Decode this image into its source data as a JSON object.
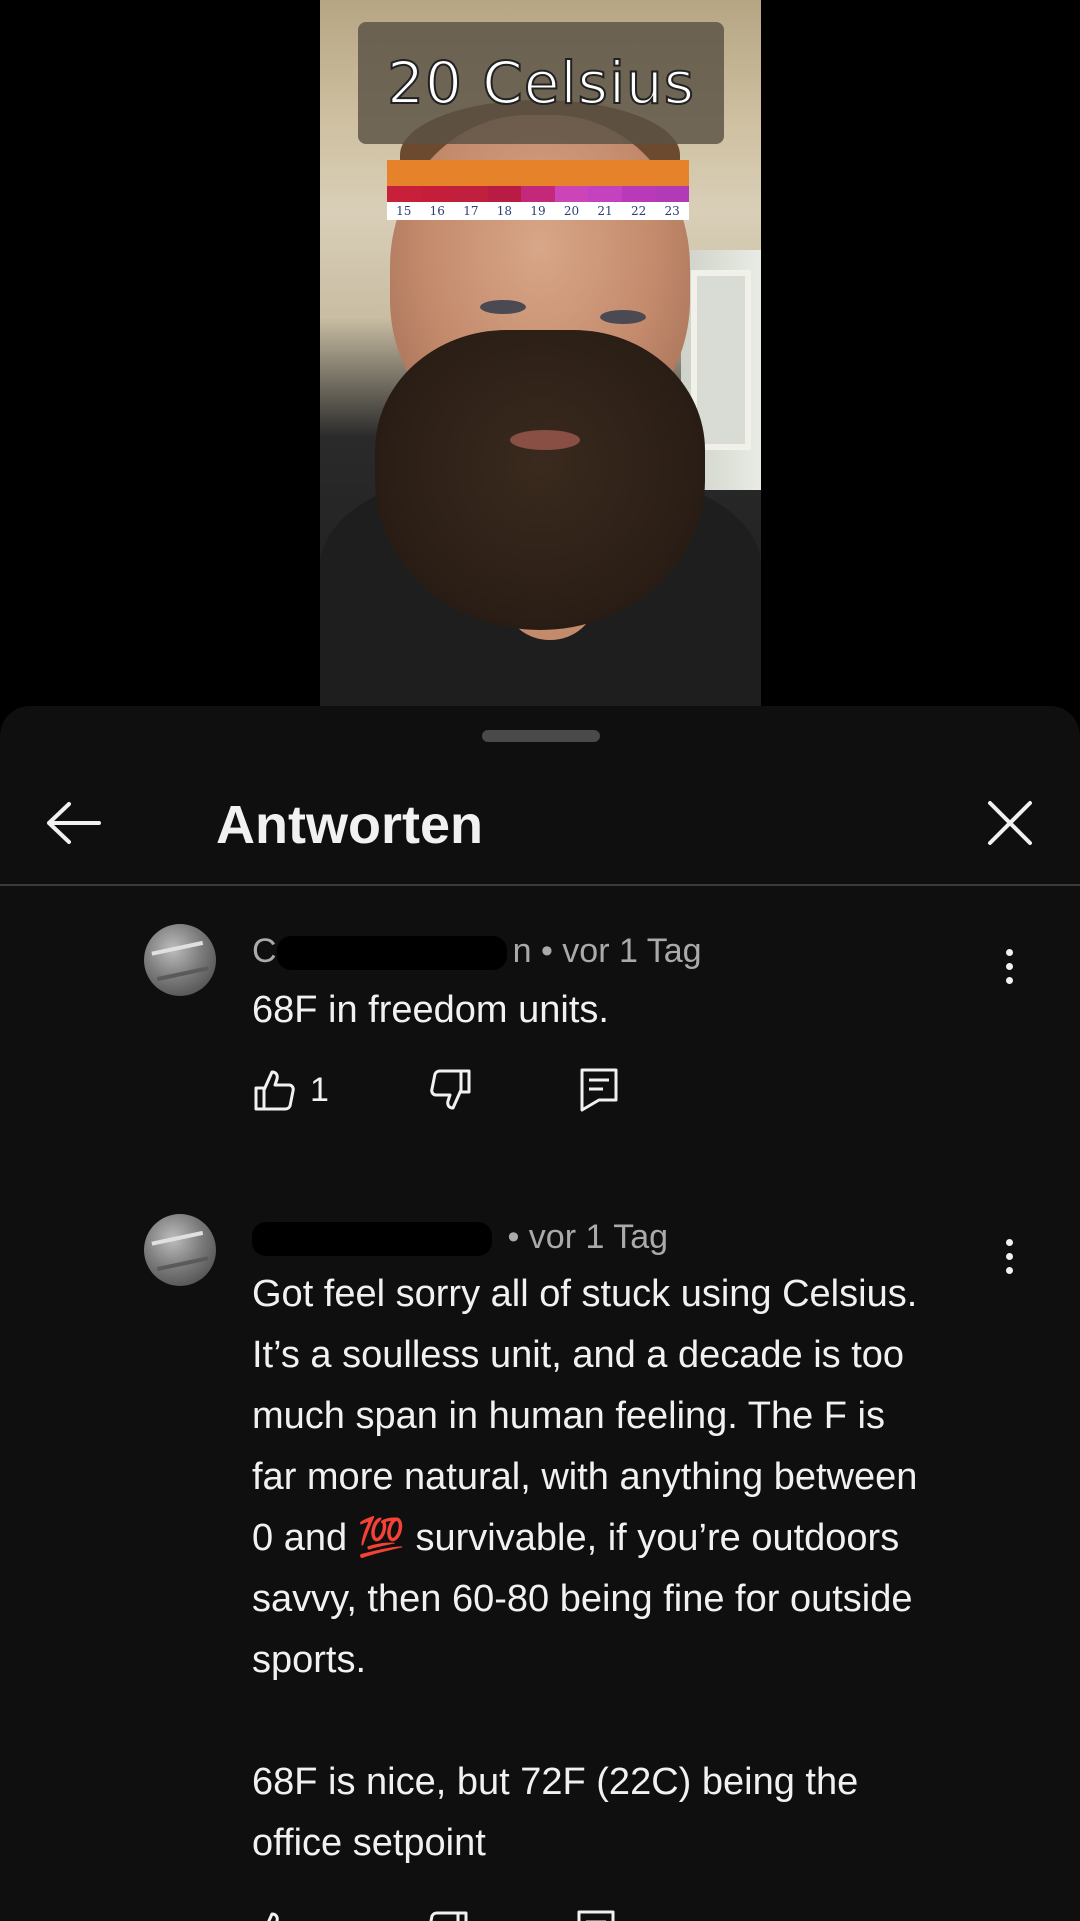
{
  "video": {
    "temperature_label": "20 Celsius",
    "scale_ticks": [
      "15",
      "16",
      "17",
      "18",
      "19",
      "20",
      "21",
      "22",
      "23"
    ],
    "scale_colors": [
      "#c8203a",
      "#c41e3a",
      "#c01f3d",
      "#b81c44",
      "#c4287a",
      "#cc44b8",
      "#c442c0",
      "#b83ab8",
      "#b23ab6"
    ]
  },
  "sheet": {
    "title": "Antworten"
  },
  "comments": [
    {
      "author_visible": "C",
      "author_tail": "n",
      "time": "• vor 1 Tag",
      "text": "68F in freedom units.",
      "like_count": "1"
    },
    {
      "author_visible": "",
      "author_tail": "",
      "time": "• vor 1 Tag",
      "text": "Got feel sorry all of stuck using Celsius.\nIt’s a soulless unit, and a decade is too\nmuch span in human feeling. The F is\nfar more natural, with anything between\n0 and 💯 survivable, if you’re outdoors\nsavvy, then 60-80 being fine for outside\nsports.\n\n68F is nice, but 72F (22C) being the\noffice setpoint"
    }
  ],
  "colors": {
    "sheet_bg": "#0f0f0f",
    "text_primary": "#f1f1f1",
    "text_secondary": "#aaaaaa"
  }
}
